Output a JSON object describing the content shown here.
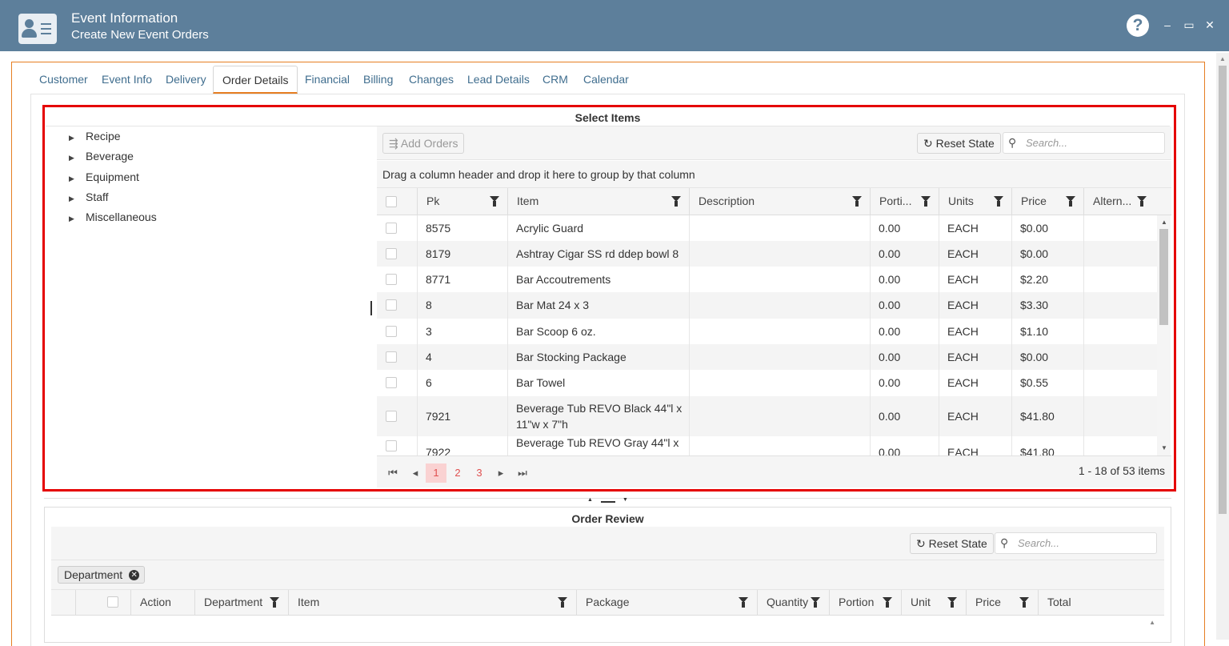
{
  "window": {
    "title": "Event Information",
    "subtitle": "Create New Event Orders",
    "help": "?",
    "minimize": "–",
    "maximize": "▭",
    "close": "✕"
  },
  "tabs": [
    "Customer",
    "Event Info",
    "Delivery",
    "Order Details",
    "Financial",
    "Billing",
    "Changes",
    "Lead Details",
    "CRM",
    "Calendar"
  ],
  "active_tab": "Order Details",
  "select_items": {
    "title": "Select Items",
    "tree": [
      "Recipe",
      "Beverage",
      "Equipment",
      "Staff",
      "Miscellaneous"
    ],
    "add_orders": "Add Orders",
    "reset_state": "Reset State",
    "search_placeholder": "Search...",
    "group_hint": "Drag a column header and drop it here to group by that column",
    "columns": [
      "Pk",
      "Item",
      "Description",
      "Porti...",
      "Units",
      "Price",
      "Altern..."
    ],
    "rows": [
      {
        "pk": "8575",
        "item": "Acrylic Guard",
        "item2": "",
        "desc": "",
        "portion": "0.00",
        "units": "EACH",
        "price": "$0.00",
        "alt": ""
      },
      {
        "pk": "8179",
        "item": "Ashtray Cigar SS rd ddep bowl 8",
        "item2": "",
        "desc": "",
        "portion": "0.00",
        "units": "EACH",
        "price": "$0.00",
        "alt": ""
      },
      {
        "pk": "8771",
        "item": "Bar Accoutrements",
        "item2": "",
        "desc": "",
        "portion": "0.00",
        "units": "EACH",
        "price": "$2.20",
        "alt": ""
      },
      {
        "pk": "8",
        "item": "Bar Mat 24 x 3",
        "item2": "",
        "desc": "",
        "portion": "0.00",
        "units": "EACH",
        "price": "$3.30",
        "alt": ""
      },
      {
        "pk": "3",
        "item": "Bar Scoop 6 oz.",
        "item2": "",
        "desc": "",
        "portion": "0.00",
        "units": "EACH",
        "price": "$1.10",
        "alt": ""
      },
      {
        "pk": "4",
        "item": "Bar Stocking Package",
        "item2": "",
        "desc": "",
        "portion": "0.00",
        "units": "EACH",
        "price": "$0.00",
        "alt": ""
      },
      {
        "pk": "6",
        "item": "Bar Towel",
        "item2": "",
        "desc": "",
        "portion": "0.00",
        "units": "EACH",
        "price": "$0.55",
        "alt": ""
      },
      {
        "pk": "7921",
        "item": "Beverage Tub REVO Black 44\"l x",
        "item2": "11\"w x 7\"h",
        "desc": "",
        "portion": "0.00",
        "units": "EACH",
        "price": "$41.80",
        "alt": ""
      },
      {
        "pk": "7922",
        "item": "Beverage Tub REVO Gray 44\"l x",
        "item2": "",
        "desc": "",
        "portion": "0.00",
        "units": "EACH",
        "price": "$41.80",
        "alt": ""
      }
    ],
    "pager": {
      "pages": [
        "1",
        "2",
        "3"
      ],
      "current": "1",
      "info": "1 - 18 of 53 items",
      "first": "⏮",
      "prev": "◂",
      "next": "▸",
      "last": "⏭"
    }
  },
  "order_review": {
    "title": "Order Review",
    "reset_state": "Reset State",
    "search_placeholder": "Search...",
    "group_chip": "Department",
    "columns": [
      "Action",
      "Department",
      "Item",
      "Package",
      "Quantity",
      "Portion",
      "Unit",
      "Price",
      "Total"
    ]
  },
  "colors": {
    "titlebar": "#5d7f9b",
    "accent": "#e67e22",
    "highlight": "#e50000",
    "pager_current": "#fad2d2"
  },
  "icons": {
    "user_card": "user-card-icon",
    "help": "help-circle-icon",
    "filter": "filter-icon",
    "reset": "refresh-icon",
    "search": "search-icon"
  }
}
